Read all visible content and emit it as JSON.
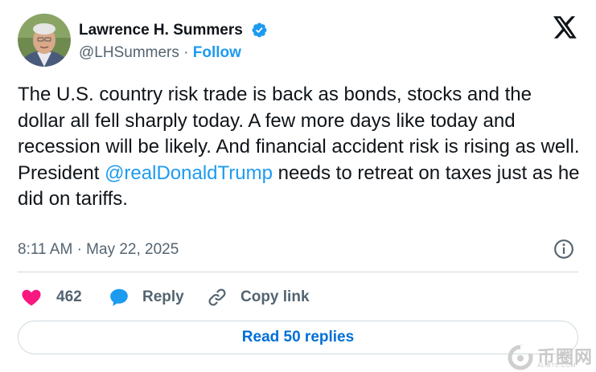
{
  "author": {
    "name": "Lawrence H. Summers",
    "handle": "@LHSummers",
    "separator": " · ",
    "follow_label": "Follow"
  },
  "tweet": {
    "text_before": "The U.S. country risk trade is back as bonds, stocks and the dollar all fell sharply today. A few more days like today and recession will be likely. And financial accident risk is rising as well. President ",
    "mention": "@realDonaldTrump",
    "text_after": " needs to retreat on taxes just as he did on tariffs.",
    "timestamp": "8:11 AM · May 22, 2025"
  },
  "actions": {
    "like_count": "462",
    "reply_label": "Reply",
    "copy_link_label": "Copy link"
  },
  "footer": {
    "read_replies_label": "Read 50 replies"
  },
  "watermark": {
    "text": "币圈网",
    "subtext": "ALIBTC.COM"
  },
  "colors": {
    "accent_blue": "#1d9bf0",
    "link_blue": "#006fd6",
    "like_pink": "#f91880",
    "secondary_text": "#536471",
    "border": "#cfd9de"
  },
  "icons": {
    "verified": "verified-badge-icon",
    "x_logo": "x-logo-icon",
    "info": "info-icon",
    "like": "heart-icon",
    "reply": "speech-bubble-icon",
    "copy_link": "link-icon"
  }
}
